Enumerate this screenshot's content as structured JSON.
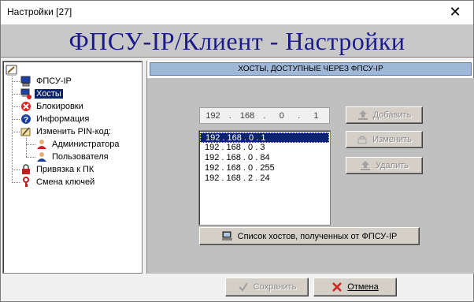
{
  "window": {
    "title": "Настройки [27]",
    "close_glyph": "✕"
  },
  "banner": {
    "text": "ФПСУ-IP/Клиент - Настройки"
  },
  "tree": {
    "items": [
      {
        "label": "ФПСУ-IP",
        "icon": "computer-icon"
      },
      {
        "label": "Хосты",
        "icon": "hosts-icon",
        "selected": true
      },
      {
        "label": "Блокировки",
        "icon": "block-icon"
      },
      {
        "label": "Информация",
        "icon": "info-icon"
      },
      {
        "label": "Изменить PIN-код:",
        "icon": "pin-icon"
      },
      {
        "label": "Администратора",
        "icon": "admin-user-icon"
      },
      {
        "label": "Пользователя",
        "icon": "user-icon"
      },
      {
        "label": "Привязка к ПК",
        "icon": "lock-icon"
      },
      {
        "label": "Смена ключей",
        "icon": "key-icon"
      }
    ]
  },
  "section": {
    "header": "ХОСТЫ, ДОСТУПНЫЕ ЧЕРЕЗ ФПСУ-IP"
  },
  "ip_input": {
    "o1": "192",
    "o2": "168",
    "o3": "0",
    "o4": "1",
    "sep": "."
  },
  "hosts": [
    "192 . 168 . 0 . 1",
    "192 . 168 . 0 . 3",
    "192 . 168 . 0 . 84",
    "192 . 168 . 0 . 255",
    "192 . 168 . 2 . 24"
  ],
  "buttons": {
    "add": "Добавить",
    "change": "Изменить",
    "delete": "Удалить",
    "host_list": "Список хостов, полученных от ФПСУ-IP",
    "save": "Сохранить",
    "cancel": "Отмена"
  },
  "colors": {
    "banner_text": "#1a1a8c",
    "selection": "#0a246a",
    "header_bg": "#9fb8d8"
  }
}
